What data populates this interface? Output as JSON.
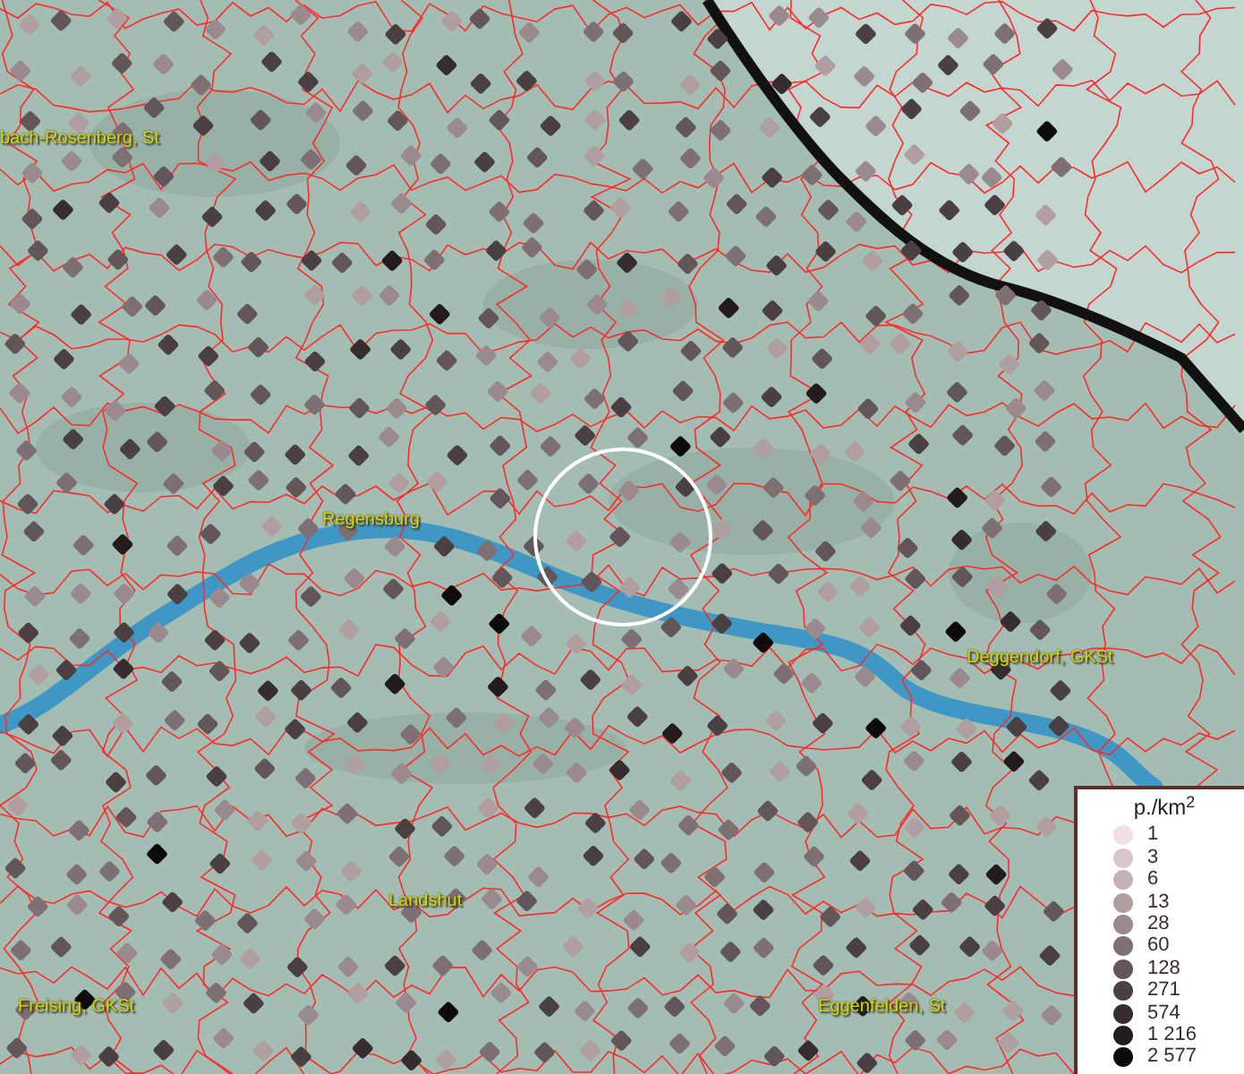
{
  "map": {
    "places": [
      {
        "name": "bach-Rosenberg, St"
      },
      {
        "name": "Regensburg"
      },
      {
        "name": "Deggendorf, GKSt"
      },
      {
        "name": "Landshut"
      },
      {
        "name": "Freising, GKSt"
      },
      {
        "name": "Eggenfelden, St"
      }
    ]
  },
  "legend": {
    "title": "p./km$^{2}$",
    "entries": [
      {
        "label": "1",
        "color": "#f3dfe0"
      },
      {
        "label": "3",
        "color": "#dcc5c8"
      },
      {
        "label": "6",
        "color": "#c6b2b5"
      },
      {
        "label": "13",
        "color": "#b09ea1"
      },
      {
        "label": "28",
        "color": "#9a8a8d"
      },
      {
        "label": "60",
        "color": "#7e7072"
      },
      {
        "label": "128",
        "color": "#625658"
      },
      {
        "label": "271",
        "color": "#4a4042"
      },
      {
        "label": "574",
        "color": "#352d2f"
      },
      {
        "label": "1 216",
        "color": "#221c1d"
      },
      {
        "label": "2 577",
        "color": "#0d0b0b"
      }
    ]
  }
}
